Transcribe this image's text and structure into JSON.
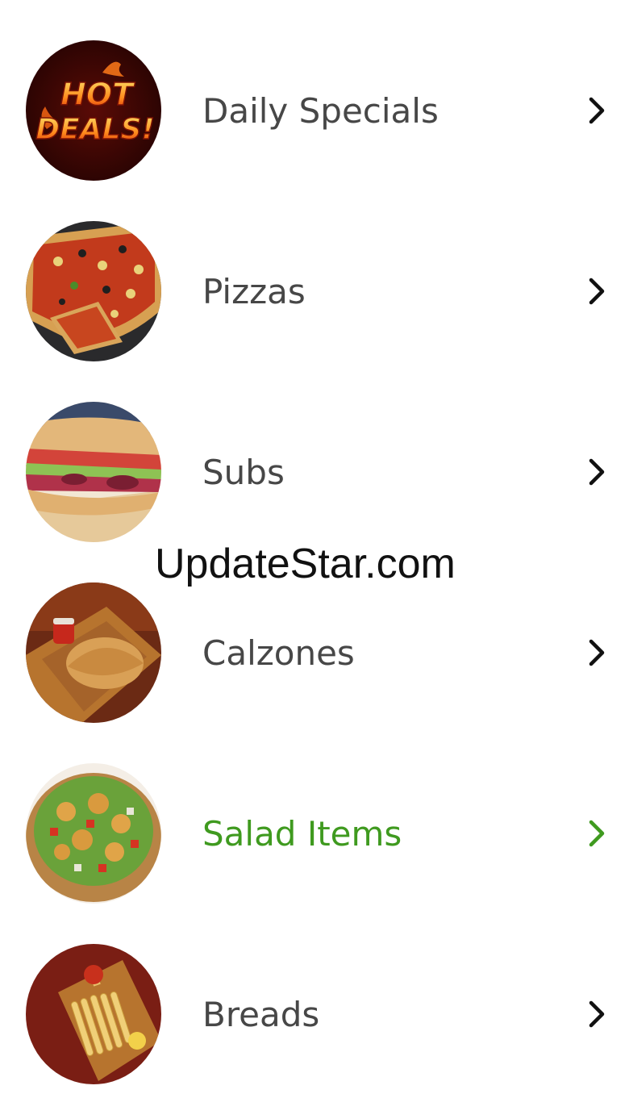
{
  "menu": {
    "items": [
      {
        "label": "Daily Specials",
        "image": "hot-deals-image",
        "image_text": [
          "HOT",
          "DEALS!"
        ],
        "active": false
      },
      {
        "label": "Pizzas",
        "image": "pizza-image",
        "active": false
      },
      {
        "label": "Subs",
        "image": "sub-sandwich-image",
        "active": false
      },
      {
        "label": "Calzones",
        "image": "calzone-image",
        "active": false
      },
      {
        "label": "Salad Items",
        "image": "salad-image",
        "active": true
      },
      {
        "label": "Breads",
        "image": "breadsticks-image",
        "active": false
      }
    ]
  },
  "colors": {
    "label": "#474747",
    "active_label": "#3f9a1f",
    "chevron": "#111111",
    "active_chevron": "#3f9a1f",
    "background": "#ffffff"
  },
  "icons": {
    "chevron": "chevron-right-icon"
  },
  "watermark": {
    "text": "UpdateStar.com"
  }
}
